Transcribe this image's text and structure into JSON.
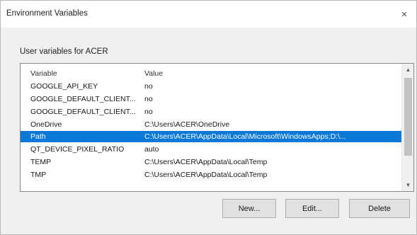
{
  "window": {
    "title": "Environment Variables",
    "close_glyph": "×"
  },
  "user_vars": {
    "group_label": "User variables for ACER",
    "columns": [
      "Variable",
      "Value"
    ],
    "rows": [
      {
        "variable": "GOOGLE_API_KEY",
        "value": "no"
      },
      {
        "variable": "GOOGLE_DEFAULT_CLIENT...",
        "value": "no"
      },
      {
        "variable": "GOOGLE_DEFAULT_CLIENT...",
        "value": "no"
      },
      {
        "variable": "OneDrive",
        "value": "C:\\Users\\ACER\\OneDrive"
      },
      {
        "variable": "Path",
        "value": "C:\\Users\\ACER\\AppData\\Local\\Microsoft\\WindowsApps;D:\\...",
        "selected": true
      },
      {
        "variable": "QT_DEVICE_PIXEL_RATIO",
        "value": "auto"
      },
      {
        "variable": "TEMP",
        "value": "C:\\Users\\ACER\\AppData\\Local\\Temp"
      },
      {
        "variable": "TMP",
        "value": "C:\\Users\\ACER\\AppData\\Local\\Temp"
      }
    ]
  },
  "scrollbar": {
    "up_glyph": "▲",
    "down_glyph": "▼"
  },
  "buttons": {
    "new_label": "New...",
    "edit_label": "Edit...",
    "delete_label": "Delete"
  },
  "colors": {
    "selection": "#0a78d7",
    "window_bg": "#f0f0f0"
  }
}
